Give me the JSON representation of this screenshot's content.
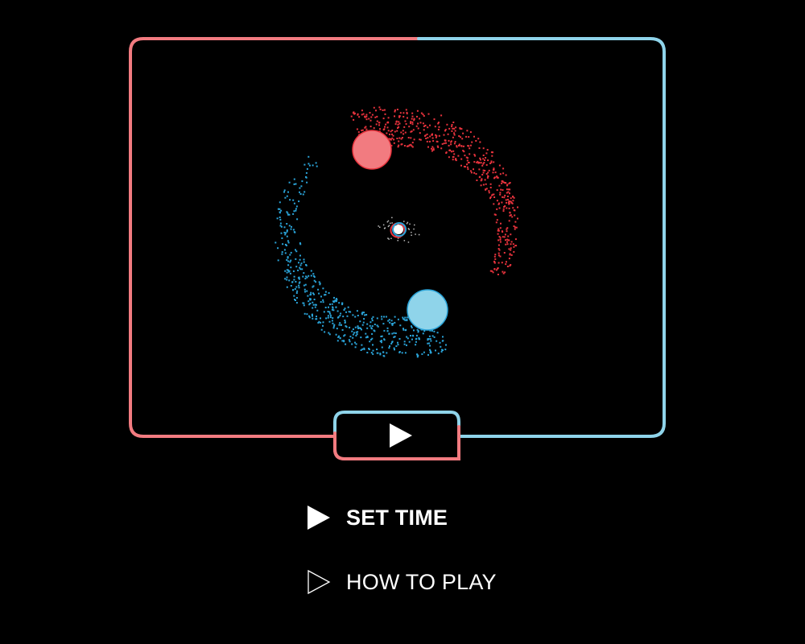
{
  "colors": {
    "red": "#f27b80",
    "blue": "#8fd4ea",
    "red_particle": "#e8333d",
    "blue_particle": "#2aa3d8",
    "background": "#000000",
    "text": "#ffffff"
  },
  "game": {
    "arena": "split-frame",
    "players": [
      "red-ball",
      "blue-ball"
    ],
    "center_object": "core-orb"
  },
  "controls": {
    "play_icon": "play-icon"
  },
  "menu": {
    "items": [
      {
        "label": "SET TIME",
        "icon": "filled-triangle-icon",
        "selected": true
      },
      {
        "label": "HOW TO PLAY",
        "icon": "outline-triangle-icon",
        "selected": false
      }
    ]
  }
}
